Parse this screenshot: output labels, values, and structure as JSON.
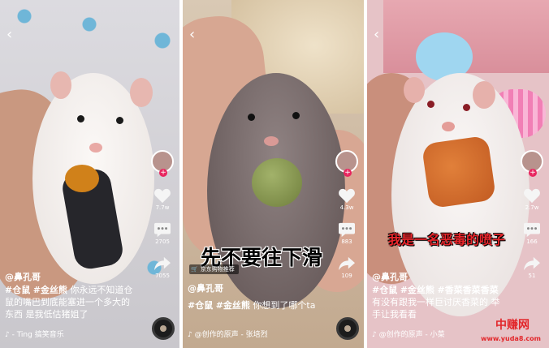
{
  "panels": [
    {
      "author": "@鼻孔哥",
      "caption_tags": [
        "#仓鼠",
        "#金丝熊"
      ],
      "caption_text": "你永远不知道仓鼠的嘴巴到底能塞进一个多大的东西 是我低估猪姐了",
      "music": "♪ - Ting   搞笑音乐",
      "likes": "7.7w",
      "comments": "2705",
      "shares": "7055"
    },
    {
      "author": "@鼻孔哥",
      "caption_tags": [
        "#仓鼠",
        "#金丝熊"
      ],
      "caption_text": "你想到了哪个ta",
      "music": "♪ @创作的原声 - 张培烈",
      "likes": "4.3w",
      "comments": "883",
      "shares": "109",
      "overlay_text": "先不要往下滑",
      "shop_text": "京东购物推荐"
    },
    {
      "author": "@鼻孔哥",
      "caption_tags": [
        "#仓鼠",
        "#金丝熊",
        "#香菜香菜香菜"
      ],
      "caption_text": "有没有跟我一样巨讨厌香菜的 举手让我看看",
      "music": "♪ @创作的原声 - 小菜",
      "likes": "2.7w",
      "comments": "166",
      "shares": "51",
      "overlay_text": "我是一名恶毒的喷子"
    }
  ],
  "watermark": {
    "brand": "中赚网",
    "url": "www.yuda8.com"
  },
  "colors": {
    "accent": "#e8255f",
    "overlay_red": "#e8262c",
    "watermark": "#e2262a"
  }
}
